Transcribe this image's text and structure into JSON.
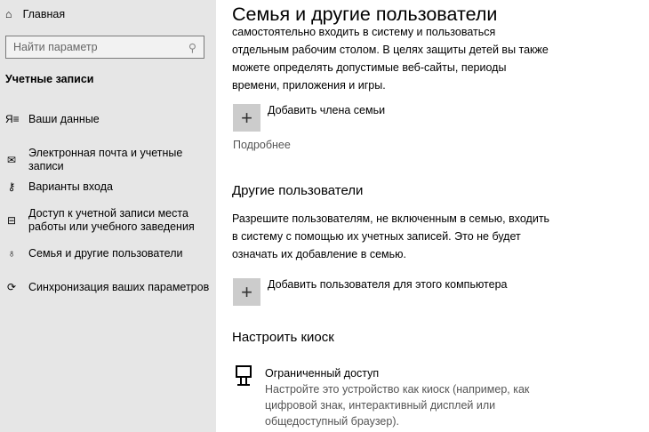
{
  "sidebar": {
    "home": "Главная",
    "search_placeholder": "Найти параметр",
    "section": "Учетные записи",
    "items": [
      {
        "label": "Ваши данные",
        "icon": "user-list-icon"
      },
      {
        "label": "Электронная почта и учетные записи",
        "icon": "mail-icon"
      },
      {
        "label": "Варианты входа",
        "icon": "key-icon"
      },
      {
        "label": "Доступ к учетной записи места работы или учебного заведения",
        "icon": "briefcase-icon"
      },
      {
        "label": "Семья и другие пользователи",
        "icon": "family-icon"
      },
      {
        "label": "Синхронизация ваших параметров",
        "icon": "sync-icon"
      }
    ]
  },
  "main": {
    "title": "Семья и другие пользователи",
    "family_text": "самостоятельно входить в систему и пользоваться отдельным рабочим столом. В целях защиты детей вы также можете определять допустимые веб-сайты, периоды времени, приложения и игры.",
    "add_family": "Добавить члена семьи",
    "more": "Подробнее",
    "others_heading": "Другие пользователи",
    "others_text": "Разрешите пользователям, не включенным в семью, входить в систему с помощью их учетных записей. Это не будет означать их добавление в семью.",
    "add_user": "Добавить пользователя для этого компьютера",
    "kiosk_heading": "Настроить киоск",
    "kiosk_title": "Ограниченный доступ",
    "kiosk_desc": "Настройте это устройство как киоск (например, как цифровой знак, интерактивный дисплей или общедоступный браузер)."
  }
}
